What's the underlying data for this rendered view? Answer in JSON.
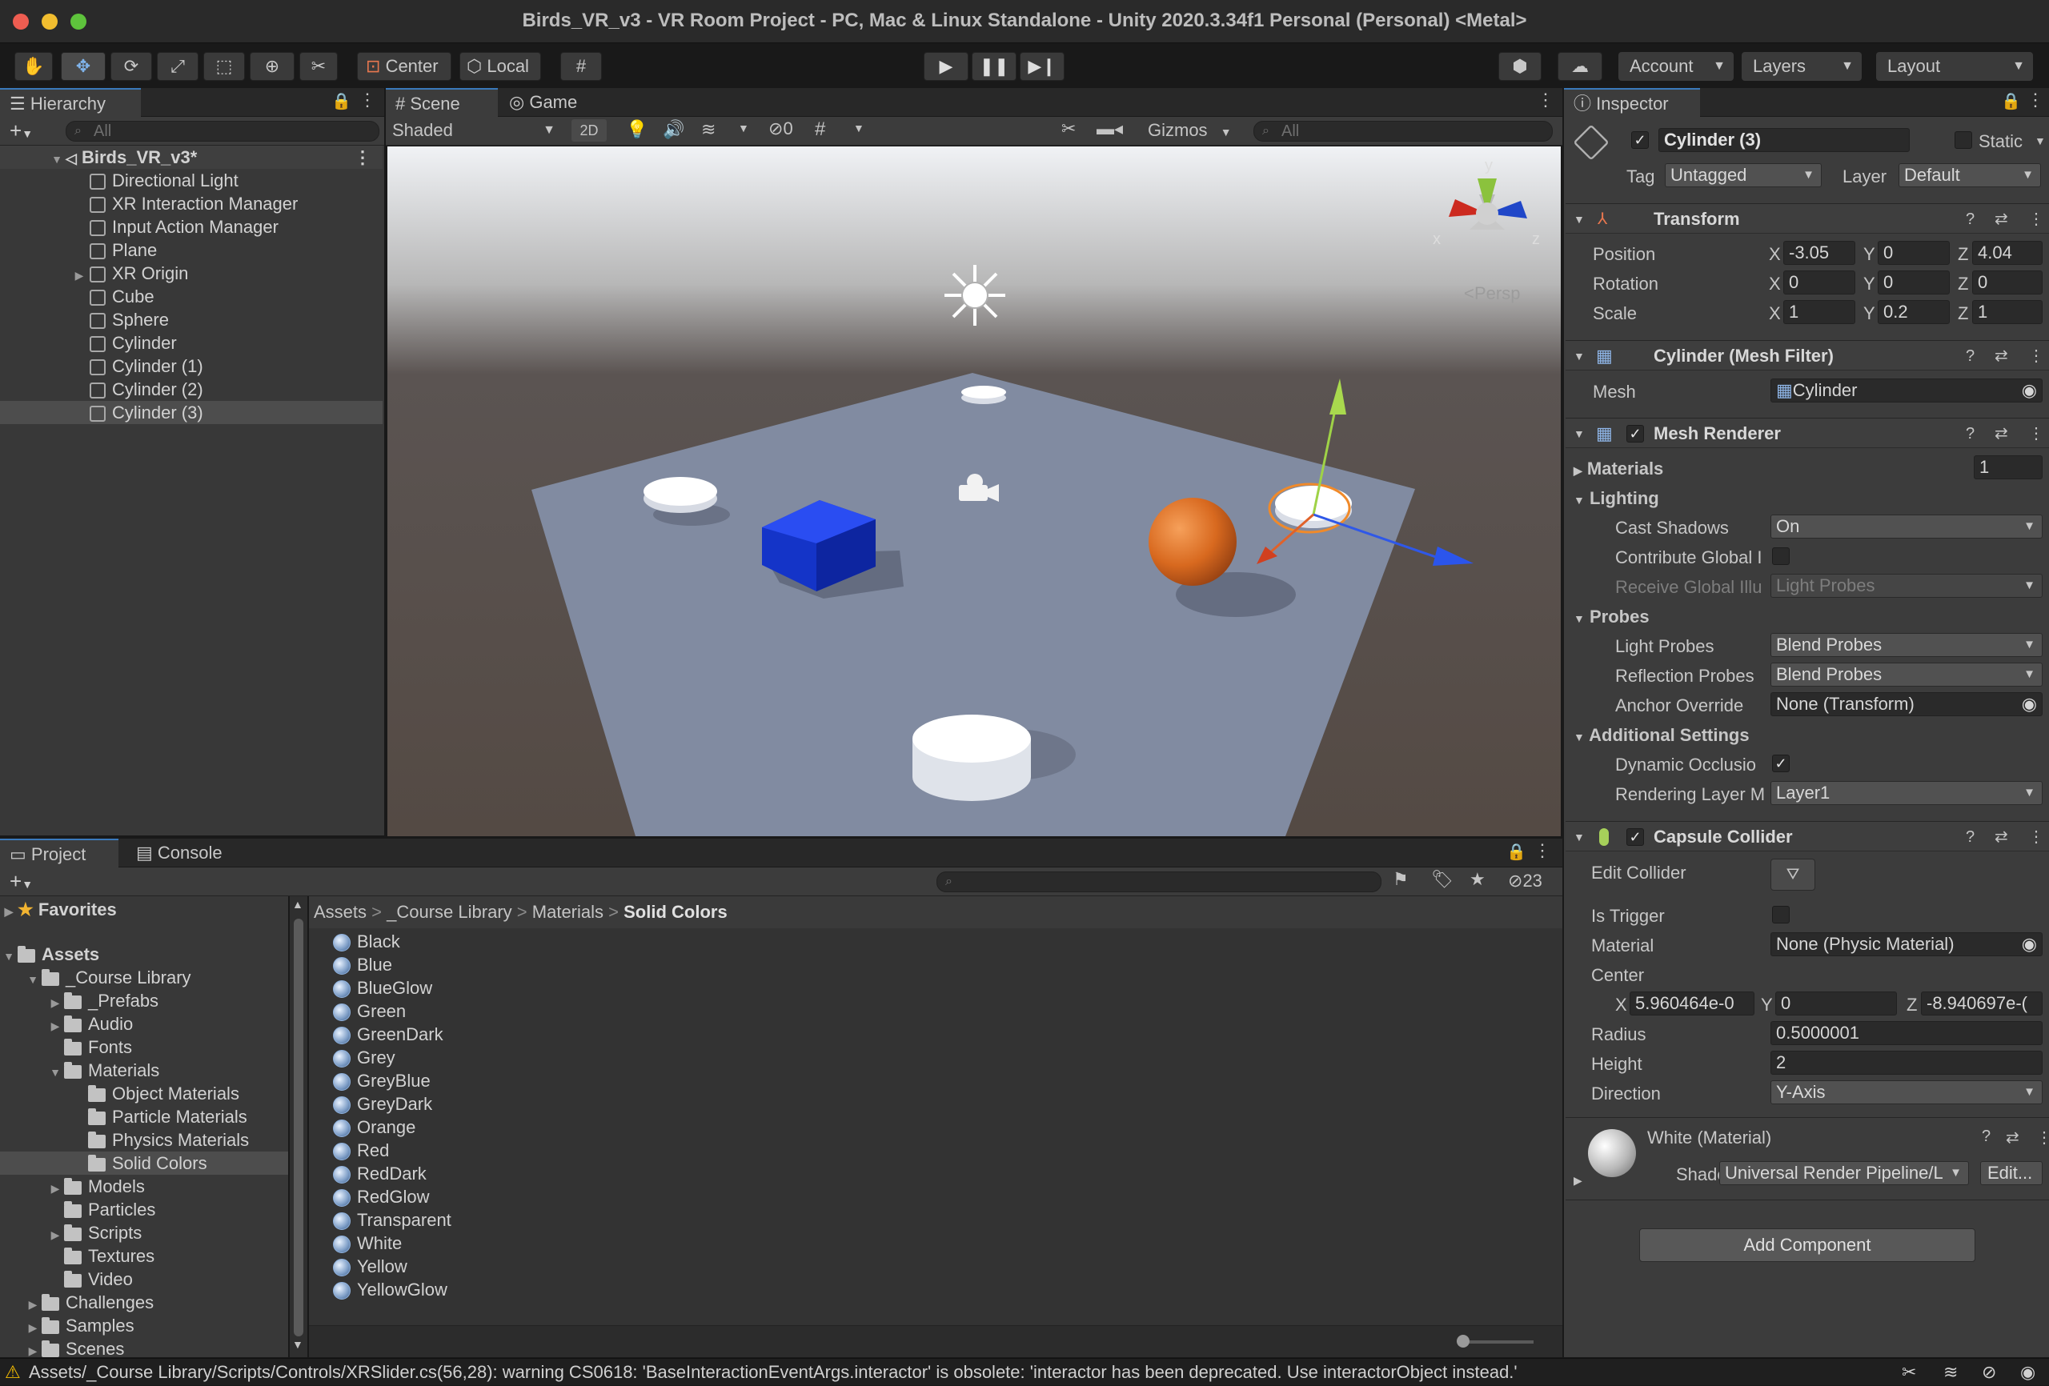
{
  "window": {
    "title": "Birds_VR_v3 - VR Room Project - PC, Mac & Linux Standalone - Unity 2020.3.34f1 Personal (Personal) <Metal>"
  },
  "toolbar": {
    "pivot_label": "Center",
    "space_label": "Local",
    "account_label": "Account",
    "layers_label": "Layers",
    "layout_label": "Layout"
  },
  "hierarchy": {
    "tab_label": "Hierarchy",
    "search_placeholder": "All",
    "scene_name": "Birds_VR_v3*",
    "items": [
      "Directional Light",
      "XR Interaction Manager",
      "Input Action Manager",
      "Plane",
      "XR Origin",
      "Cube",
      "Sphere",
      "Cylinder",
      "Cylinder (1)",
      "Cylinder (2)",
      "Cylinder (3)"
    ],
    "selected": "Cylinder (3)"
  },
  "scene_view": {
    "scene_tab": "Scene",
    "game_tab": "Game",
    "shading_mode": "Shaded",
    "mode_2d": "2D",
    "hidden_count": "0",
    "gizmos_label": "Gizmos",
    "search_placeholder": "All",
    "projection_label": "Persp",
    "axis_labels": {
      "x": "x",
      "y": "y",
      "z": "z"
    }
  },
  "project": {
    "project_tab": "Project",
    "console_tab": "Console",
    "hidden_count": "23",
    "favorites_label": "Favorites",
    "assets_label": "Assets",
    "tree": {
      "course_library": "_Course Library",
      "prefabs": "_Prefabs",
      "audio": "Audio",
      "fonts": "Fonts",
      "materials": "Materials",
      "object_materials": "Object Materials",
      "particle_materials": "Particle Materials",
      "physics_materials": "Physics Materials",
      "solid_colors": "Solid Colors",
      "models": "Models",
      "particles": "Particles",
      "scripts": "Scripts",
      "textures": "Textures",
      "video": "Video",
      "challenges": "Challenges",
      "samples": "Samples",
      "scenes": "Scenes"
    },
    "breadcrumb": [
      "Assets",
      "_Course Library",
      "Materials",
      "Solid Colors"
    ],
    "files": [
      "Black",
      "Blue",
      "BlueGlow",
      "Green",
      "GreenDark",
      "Grey",
      "GreyBlue",
      "GreyDark",
      "Orange",
      "Red",
      "RedDark",
      "RedGlow",
      "Transparent",
      "White",
      "Yellow",
      "YellowGlow"
    ]
  },
  "inspector": {
    "tab_label": "Inspector",
    "object_name": "Cylinder (3)",
    "static_label": "Static",
    "tag_label": "Tag",
    "tag_value": "Untagged",
    "layer_label": "Layer",
    "layer_value": "Default",
    "transform": {
      "title": "Transform",
      "position_label": "Position",
      "rotation_label": "Rotation",
      "scale_label": "Scale",
      "position": {
        "x": "-3.05",
        "y": "0",
        "z": "4.04"
      },
      "rotation": {
        "x": "0",
        "y": "0",
        "z": "0"
      },
      "scale": {
        "x": "1",
        "y": "0.2",
        "z": "1"
      }
    },
    "mesh_filter": {
      "title": "Cylinder (Mesh Filter)",
      "mesh_label": "Mesh",
      "mesh_value": "Cylinder"
    },
    "mesh_renderer": {
      "title": "Mesh Renderer",
      "materials_label": "Materials",
      "materials_count": "1",
      "lighting_label": "Lighting",
      "cast_shadows_label": "Cast Shadows",
      "cast_shadows_value": "On",
      "contribute_gi_label": "Contribute Global I",
      "receive_gi_label": "Receive Global Illu",
      "receive_gi_value": "Light Probes",
      "probes_label": "Probes",
      "light_probes_label": "Light Probes",
      "light_probes_value": "Blend Probes",
      "reflection_probes_label": "Reflection Probes",
      "reflection_probes_value": "Blend Probes",
      "anchor_override_label": "Anchor Override",
      "anchor_override_value": "None (Transform)",
      "additional_settings_label": "Additional Settings",
      "dynamic_occlusion_label": "Dynamic Occlusio",
      "rendering_layer_label": "Rendering Layer M",
      "rendering_layer_value": "Layer1"
    },
    "capsule_collider": {
      "title": "Capsule Collider",
      "edit_collider_label": "Edit Collider",
      "is_trigger_label": "Is Trigger",
      "material_label": "Material",
      "material_value": "None (Physic Material)",
      "center_label": "Center",
      "center": {
        "x": "5.960464e-0",
        "y": "0",
        "z": "-8.940697e-("
      },
      "radius_label": "Radius",
      "radius_value": "0.5000001",
      "height_label": "Height",
      "height_value": "2",
      "direction_label": "Direction",
      "direction_value": "Y-Axis"
    },
    "material": {
      "title": "White (Material)",
      "shader_label": "Shader",
      "shader_value": "Universal Render Pipeline/L",
      "edit_label": "Edit..."
    },
    "add_component_label": "Add Component"
  },
  "status": {
    "message": "Assets/_Course Library/Scripts/Controls/XRSlider.cs(56,28): warning CS0618: 'BaseInteractionEventArgs.interactor' is obsolete: 'interactor has been deprecated. Use interactorObject instead.'"
  },
  "colors": {
    "accent": "#3a79bb",
    "selection": "#4d4d4d",
    "warning": "#f4bc02"
  }
}
